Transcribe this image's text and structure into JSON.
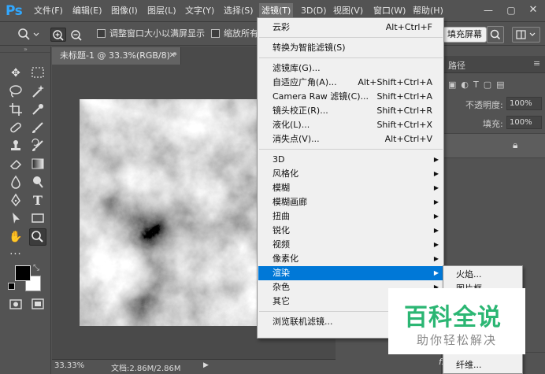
{
  "app": {
    "logo": "Ps"
  },
  "menubar": {
    "items": [
      "文件(F)",
      "编辑(E)",
      "图像(I)",
      "图层(L)",
      "文字(Y)",
      "选择(S)",
      "滤镜(T)",
      "3D(D)",
      "视图(V)",
      "窗口(W)",
      "帮助(H)"
    ],
    "open_item": "滤镜(T)"
  },
  "options_bar": {
    "checkbox_resize_label": "调整窗口大小以满屏显示",
    "checkbox_zoom_all_label": "缩放所有",
    "fill_screen_button": "填充屏幕"
  },
  "document": {
    "tab_title": "未标题-1 @ 33.3%(RGB/8) *",
    "zoom_status": "33.33%",
    "doc_size": "文档:2.86M/2.86M"
  },
  "filter_menu": {
    "items": [
      {
        "label": "云彩",
        "shortcut": "Alt+Ctrl+F",
        "submenu": false
      },
      {
        "separator": true
      },
      {
        "label": "转换为智能滤镜(S)",
        "shortcut": "",
        "submenu": false
      },
      {
        "separator": true
      },
      {
        "label": "滤镜库(G)...",
        "shortcut": "",
        "submenu": false
      },
      {
        "label": "自适应广角(A)...",
        "shortcut": "Alt+Shift+Ctrl+A",
        "submenu": false
      },
      {
        "label": "Camera Raw 滤镜(C)...",
        "shortcut": "Shift+Ctrl+A",
        "submenu": false
      },
      {
        "label": "镜头校正(R)...",
        "shortcut": "Shift+Ctrl+R",
        "submenu": false
      },
      {
        "label": "液化(L)...",
        "shortcut": "Shift+Ctrl+X",
        "submenu": false
      },
      {
        "label": "消失点(V)...",
        "shortcut": "Alt+Ctrl+V",
        "submenu": false
      },
      {
        "separator": true
      },
      {
        "label": "3D",
        "shortcut": "",
        "submenu": true
      },
      {
        "label": "风格化",
        "shortcut": "",
        "submenu": true
      },
      {
        "label": "模糊",
        "shortcut": "",
        "submenu": true
      },
      {
        "label": "模糊画廊",
        "shortcut": "",
        "submenu": true
      },
      {
        "label": "扭曲",
        "shortcut": "",
        "submenu": true
      },
      {
        "label": "锐化",
        "shortcut": "",
        "submenu": true
      },
      {
        "label": "视频",
        "shortcut": "",
        "submenu": true
      },
      {
        "label": "像素化",
        "shortcut": "",
        "submenu": true
      },
      {
        "label": "渲染",
        "shortcut": "",
        "submenu": true,
        "highlighted": true
      },
      {
        "label": "杂色",
        "shortcut": "",
        "submenu": true
      },
      {
        "label": "其它",
        "shortcut": "",
        "submenu": true
      },
      {
        "separator": true
      },
      {
        "label": "浏览联机滤镜...",
        "shortcut": "",
        "submenu": false
      }
    ]
  },
  "render_submenu": {
    "items": [
      "火焰...",
      "图片框...",
      "纤维..."
    ]
  },
  "right_panel": {
    "tab_partial": "路径",
    "opacity_label": "不透明度:",
    "opacity_value": "100%",
    "fill_label": "填充:",
    "fill_value": "100%"
  },
  "watermark": {
    "main": "百科全说",
    "sub": "助你轻松解决"
  },
  "colors": {
    "ui_bg": "#535353",
    "menu_bg": "#f0f0f0",
    "highlight": "#0078d7",
    "ps_blue": "#31a8ff",
    "watermark_green": "#2bb673"
  }
}
